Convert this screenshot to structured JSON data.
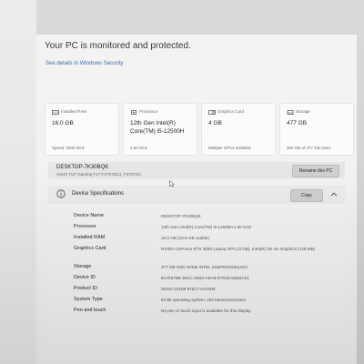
{
  "header": {
    "title": "Your PC is monitored and protected.",
    "security_link": "See details in Windows Security"
  },
  "cards": [
    {
      "icon": "ram-icon",
      "title": "Installed RAM",
      "value": "16.0 GB",
      "sub": "Speed: 3200 MHz"
    },
    {
      "icon": "processor-icon",
      "title": "Processor",
      "value": "12th Gen Intel(R) Core(TM) i5-12500H",
      "sub": "2.50 GHz"
    },
    {
      "icon": "graphics-card-icon",
      "title": "Graphics Card",
      "value": "4 GB",
      "sub": "Multiple GPUs installed"
    },
    {
      "icon": "storage-icon",
      "title": "Storage",
      "value": "477 GB",
      "sub": "350 GB of 477 GB used"
    }
  ],
  "device": {
    "name": "DESKTOP-7K30BQK",
    "model": "ASUS TUF Gaming F17 FX707ZC4_FX707ZC",
    "rename_label": "Rename this PC"
  },
  "specs": {
    "title": "Device Specifications",
    "copy_label": "Copy",
    "rows": [
      {
        "label": "Device Name",
        "value": "DESKTOP-7K30BQK"
      },
      {
        "label": "Processor",
        "value": "12th Gen Intel(R) Core(TM) i5-12500H   2.50 GHz"
      },
      {
        "label": "Installed RAM",
        "value": "16.0 GB (15.6 GB usable)"
      },
      {
        "label": "Graphics Card",
        "value": "NVIDIA GeForce RTX 3050 Laptop GPU (4 GB), Intel(R) Iris Xe Graphics (128 MB)"
      },
      {
        "label": "Storage",
        "value": "477 GB SSD NVMe INTEL SSDPEKNU512GZ"
      },
      {
        "label": "Device ID",
        "value": "9A7537B8-39CC-4E62-AEA9-D7034A6634A21"
      },
      {
        "label": "Product ID",
        "value": "00342-22158-97517-AAOEM"
      },
      {
        "label": "System Type",
        "value": "64-bit operating system, x64-based processor"
      },
      {
        "label": "Pen and touch",
        "value": "No pen or touch input is available for this display"
      }
    ]
  }
}
